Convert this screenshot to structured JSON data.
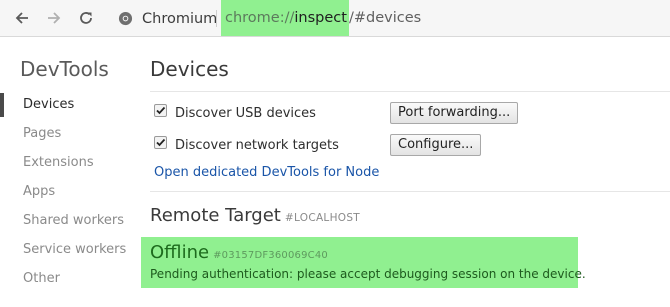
{
  "browser": {
    "site_name": "Chromium",
    "url_scheme": "chrome://",
    "url_host": "inspect",
    "url_path": "/#devices",
    "icons": [
      "back-arrow-icon",
      "forward-arrow-icon",
      "reload-icon",
      "chromium-logo-icon"
    ]
  },
  "sidebar": {
    "title": "DevTools",
    "items": [
      {
        "label": "Devices",
        "active": true
      },
      {
        "label": "Pages",
        "active": false
      },
      {
        "label": "Extensions",
        "active": false
      },
      {
        "label": "Apps",
        "active": false
      },
      {
        "label": "Shared workers",
        "active": false
      },
      {
        "label": "Service workers",
        "active": false
      },
      {
        "label": "Other",
        "active": false
      }
    ]
  },
  "main": {
    "title": "Devices",
    "discover_usb": {
      "label": "Discover USB devices",
      "checked": true
    },
    "discover_network": {
      "label": "Discover network targets",
      "checked": true
    },
    "port_forwarding_button": "Port forwarding...",
    "configure_button": "Configure...",
    "node_link": "Open dedicated DevTools for Node",
    "remote_target": {
      "title": "Remote Target",
      "host": "#LOCALHOST"
    },
    "device": {
      "name": "Offline",
      "id": "#03157DF360069C40",
      "status": "Pending authentication: please accept debugging session on the device."
    }
  },
  "colors": {
    "highlight": "#90f090",
    "link": "#1a55a8",
    "device_text": "#1d6b1d"
  }
}
